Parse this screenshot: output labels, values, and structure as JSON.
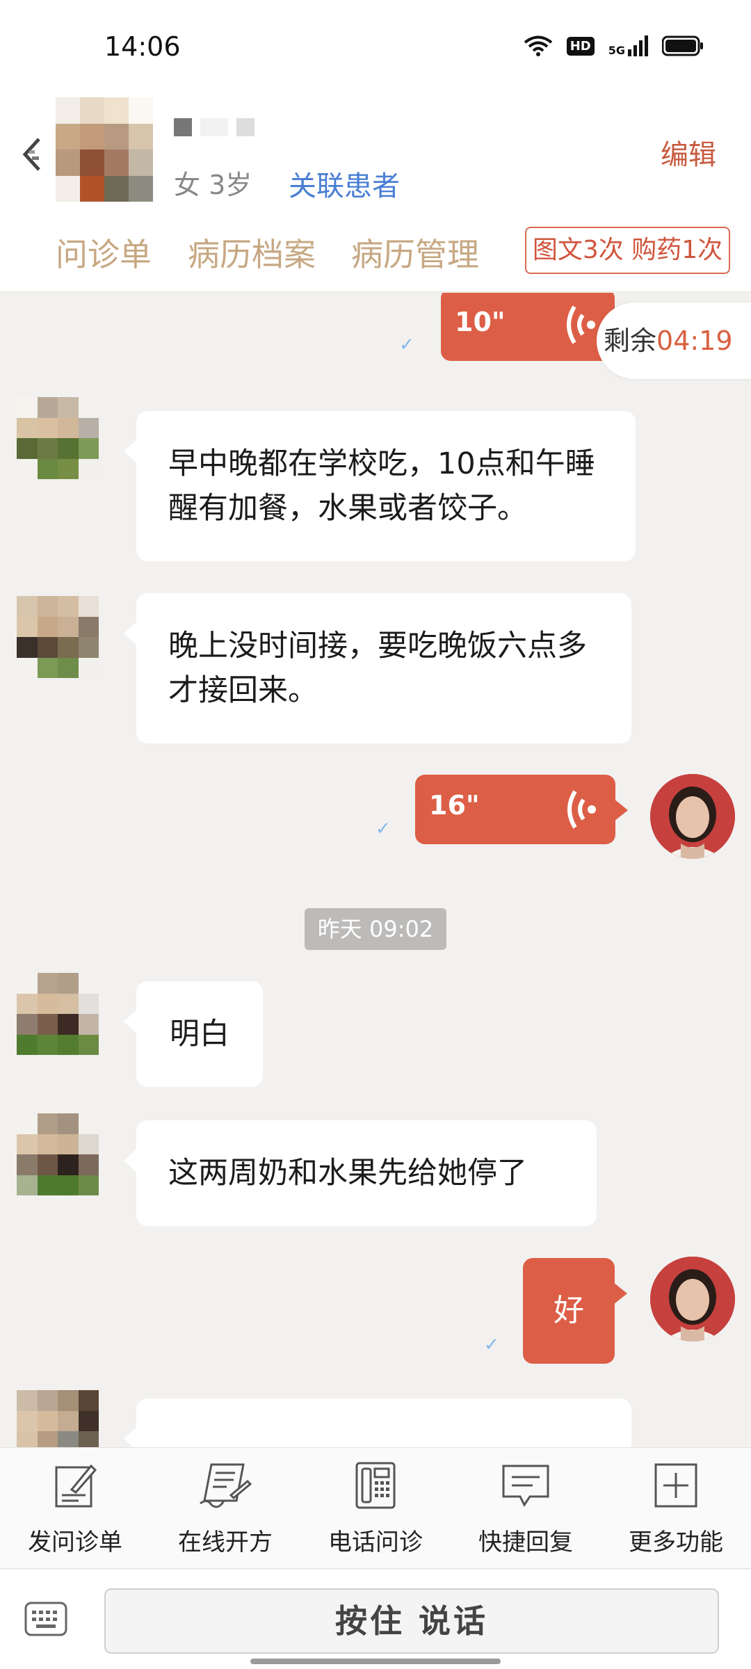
{
  "status_bar": {
    "time": "14:06",
    "hd": "HD",
    "network": "5G"
  },
  "header": {
    "gender_age": "女 3岁",
    "link_patient_label": "关联患者",
    "edit_label": "编辑",
    "tabs": [
      "问诊单",
      "病历档案",
      "病历管理"
    ],
    "quota_badge": "图文3次 购药1次"
  },
  "chat": {
    "remaining": {
      "label": "剩余",
      "time": "04:19"
    },
    "messages": [
      {
        "from": "doctor",
        "type": "voice",
        "duration": "10\""
      },
      {
        "from": "patient",
        "type": "text",
        "text": "早中晚都在学校吃，10点和午睡醒有加餐，水果或者饺子。"
      },
      {
        "from": "patient",
        "type": "text",
        "text": "晚上没时间接，要吃晚饭六点多才接回来。"
      },
      {
        "from": "doctor",
        "type": "voice",
        "duration": "16\""
      },
      {
        "type": "timestamp",
        "text": "昨天 09:02"
      },
      {
        "from": "patient",
        "type": "text",
        "text": "明白"
      },
      {
        "from": "patient",
        "type": "text",
        "text": "这两周奶和水果先给她停了"
      },
      {
        "from": "doctor",
        "type": "text",
        "text": "好"
      }
    ]
  },
  "toolbar": {
    "items": [
      {
        "label": "发问诊单",
        "icon": "form-pen-icon"
      },
      {
        "label": "在线开方",
        "icon": "prescription-icon"
      },
      {
        "label": "电话问诊",
        "icon": "phone-icon"
      },
      {
        "label": "快捷回复",
        "icon": "quick-reply-icon"
      },
      {
        "label": "更多功能",
        "icon": "plus-box-icon"
      }
    ]
  },
  "input": {
    "hold_to_talk": "按住 说话"
  },
  "colors": {
    "accent": "#dd5e46",
    "link": "#4a7fd4",
    "tab": "#c7a883",
    "background": "#f2f1ef"
  }
}
